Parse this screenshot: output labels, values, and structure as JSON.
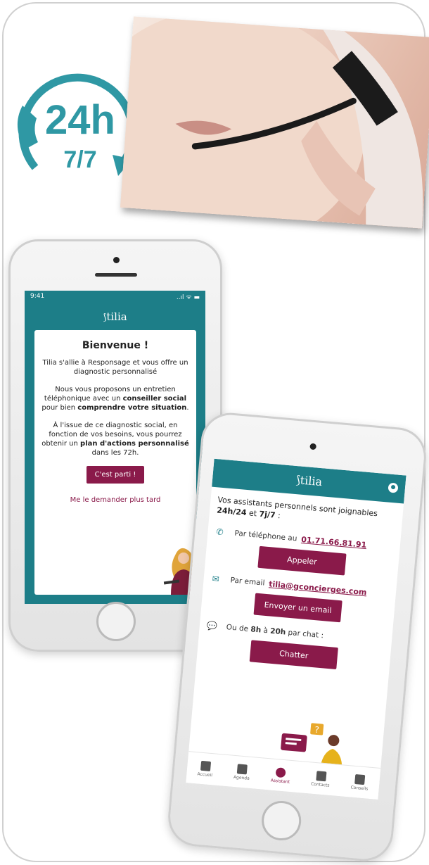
{
  "badge": {
    "hours": "24h",
    "days": "7/7"
  },
  "phone1": {
    "status_time": "9:41",
    "status_icons": "..ıl ᯤ ▬",
    "brand": "tilia",
    "title": "Bienvenue !",
    "para1": "Tilia s'allie à Responsage et vous offre un diagnostic personnalisé",
    "para2": {
      "t1": "Nous vous proposons un entretien téléphonique avec un ",
      "b1": "conseiller social",
      "t2": " pour bien ",
      "b2": "comprendre votre situation",
      "t3": "."
    },
    "para3": {
      "t1": "À l'issue de ce diagnostic social, en fonction de vos besoins, vous pourrez obtenir un ",
      "b1": "plan d'actions personnalisé",
      "t2": " dans les 72h."
    },
    "cta": "C'est parti !",
    "later": "Me le demander plus tard"
  },
  "phone2": {
    "brand": "tilia",
    "intro": {
      "t1": "Vos assistants personnels sont joignables ",
      "b1": "24h/24",
      "t2": " et ",
      "b2": "7j/7",
      "t3": " :"
    },
    "phone_label": "Par téléphone au",
    "phone_number": "01.71.66.81.91",
    "call_button": "Appeler",
    "email_label": "Par email",
    "email_address": "tilia@gconcierges.com",
    "email_button": "Envoyer un email",
    "chat": {
      "t1": "Ou de ",
      "b1": "8h",
      "t2": " à ",
      "b2": "20h",
      "t3": " par chat :"
    },
    "chat_button": "Chatter",
    "bubble_q": "?",
    "tabs": [
      "Accueil",
      "Agenda",
      "Assistant",
      "Contacts",
      "Conseils"
    ]
  },
  "colors": {
    "teal": "#1d7e88",
    "plum": "#8a1a4a"
  }
}
